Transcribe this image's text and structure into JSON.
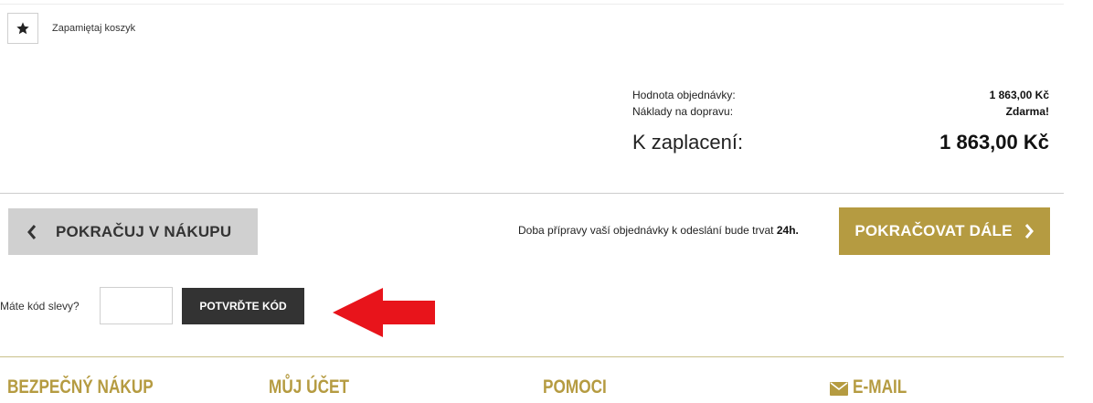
{
  "cart": {
    "remember_label": "Zapamiętaj koszyk",
    "remember_icon": "star-icon"
  },
  "summary": {
    "order_value_label": "Hodnota objednávky:",
    "order_value": "1 863,00 Kč",
    "shipping_label": "Náklady na dopravu:",
    "shipping_value": "Zdarma!",
    "total_label": "K zaplacení:",
    "total_value": "1 863,00 Kč"
  },
  "navigation": {
    "back_label": "POKRAČUJ V NÁKUPU",
    "back_icon": "chevron-left-icon",
    "next_label": "POKRAČOVAT DÁLE",
    "next_icon": "chevron-right-icon",
    "prep_text": "Doba přípravy vaší objednávky k odeslání bude trvat",
    "prep_time": "24h."
  },
  "discount": {
    "label": "Máte kód slevy?",
    "input_value": "",
    "confirm_label": "POTVRĎTE KÓD",
    "annotation_icon": "red-arrow-left-icon"
  },
  "footer": {
    "col1": "BEZPEČNÝ NÁKUP",
    "col2": "MŮJ ÚČET",
    "col3": "POMOCI",
    "col4": "E-MAIL",
    "col4_icon": "envelope-icon"
  },
  "colors": {
    "accent": "#b59b41",
    "dark_button": "#333333",
    "back_button": "#d0d0d0",
    "annotation_arrow": "#e8141b"
  }
}
